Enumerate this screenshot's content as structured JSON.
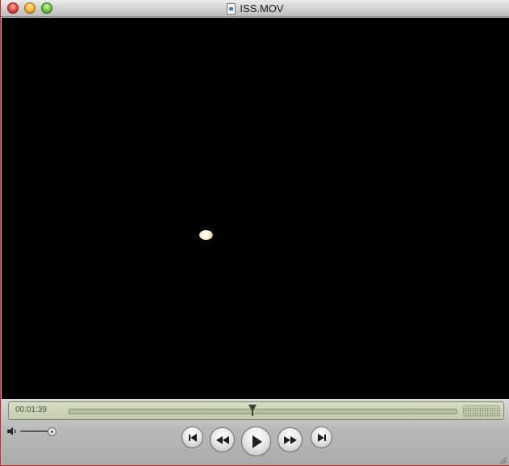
{
  "window": {
    "title": "ISS.MOV"
  },
  "player": {
    "time_elapsed": "00:01:39",
    "progress_fraction": 0.46
  },
  "icons": {
    "close": "close-icon",
    "minimize": "minimize-icon",
    "zoom": "zoom-icon",
    "document": "movie-file-icon",
    "volume": "speaker-icon",
    "previous": "skip-to-start-icon",
    "rewind": "rewind-icon",
    "play": "play-icon",
    "fast_forward": "fast-forward-icon",
    "next": "skip-to-end-icon",
    "resize": "resize-grip-icon"
  },
  "colors": {
    "window_border": "#c8252a",
    "lcd": "#d7dcc3",
    "video_background": "#000000"
  }
}
